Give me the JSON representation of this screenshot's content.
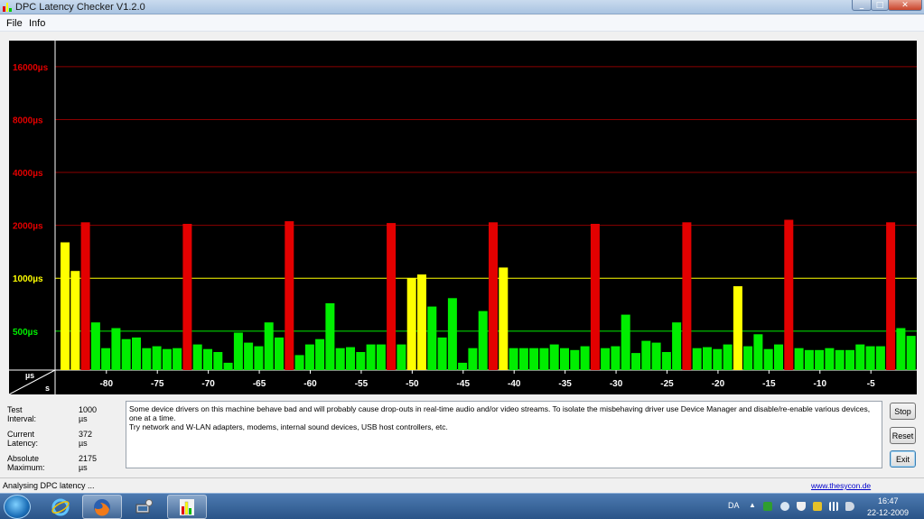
{
  "window": {
    "title": "DPC Latency Checker V1.2.0"
  },
  "menu": [
    "File",
    "Info"
  ],
  "colors": {
    "green": "#00ee00",
    "yellow": "#ffff00",
    "red": "#e30000",
    "grid_red": "#8b0000",
    "background": "#000000"
  },
  "chart_data": {
    "type": "bar",
    "y_scale": "logarithmic",
    "y_unit": "µs",
    "x_unit": "s",
    "ylim": [
      300,
      20000
    ],
    "y_ticks": [
      {
        "label": "16000µs",
        "value": 16000,
        "color": "#e30000"
      },
      {
        "label": "8000µs",
        "value": 8000,
        "color": "#e30000"
      },
      {
        "label": "4000µs",
        "value": 4000,
        "color": "#e30000"
      },
      {
        "label": "2000µs",
        "value": 2000,
        "color": "#e30000"
      },
      {
        "label": "1000µs",
        "value": 1000,
        "color": "#ffff00"
      },
      {
        "label": "500µs",
        "value": 500,
        "color": "#00ee00"
      }
    ],
    "x_ticks": [
      "-80",
      "-75",
      "-70",
      "-65",
      "-60",
      "-55",
      "-50",
      "-45",
      "-40",
      "-35",
      "-30",
      "-25",
      "-20",
      "-15",
      "-10",
      "-5"
    ],
    "x_range": [
      -84,
      -1
    ],
    "values": [
      1600,
      1100,
      2080,
      560,
      400,
      520,
      450,
      460,
      400,
      410,
      395,
      400,
      2040,
      420,
      395,
      380,
      330,
      490,
      430,
      410,
      560,
      460,
      2110,
      365,
      420,
      450,
      720,
      400,
      405,
      380,
      420,
      420,
      2060,
      420,
      1000,
      1050,
      690,
      460,
      770,
      330,
      400,
      650,
      2080,
      1150,
      400,
      400,
      400,
      400,
      420,
      400,
      390,
      410,
      2040,
      400,
      410,
      620,
      375,
      440,
      430,
      380,
      560,
      2080,
      400,
      405,
      395,
      420,
      900,
      410,
      480,
      395,
      420,
      2150,
      400,
      390,
      390,
      400,
      390,
      390,
      420,
      410,
      410,
      2080,
      520,
      470
    ]
  },
  "axis_corner": {
    "y_unit": "µs",
    "x_unit": "s"
  },
  "stats": [
    {
      "label": "Test Interval:",
      "value": "1000 µs"
    },
    {
      "label": "Current Latency:",
      "value": "372 µs"
    },
    {
      "label": "Absolute Maximum:",
      "value": "2175 µs"
    }
  ],
  "message": {
    "line1": "Some device drivers on this machine behave bad and will probably cause drop-outs in real-time audio and/or video streams. To isolate the misbehaving driver use Device Manager and disable/re-enable various devices, one at a time.",
    "line2": "Try network and W-LAN adapters, modems, internal sound devices, USB host controllers, etc."
  },
  "buttons": {
    "stop": "Stop",
    "reset": "Reset",
    "exit": "Exit"
  },
  "status": {
    "text": "Analysing DPC latency ...",
    "link": "www.thesycon.de"
  },
  "taskbar": {
    "apps": [
      "start-orb",
      "internet-explorer-icon",
      "firefox-icon",
      "network-computer-icon",
      "dpc-latency-checker-icon"
    ],
    "language": "DA",
    "time": "16:47",
    "date": "22-12-2009"
  }
}
